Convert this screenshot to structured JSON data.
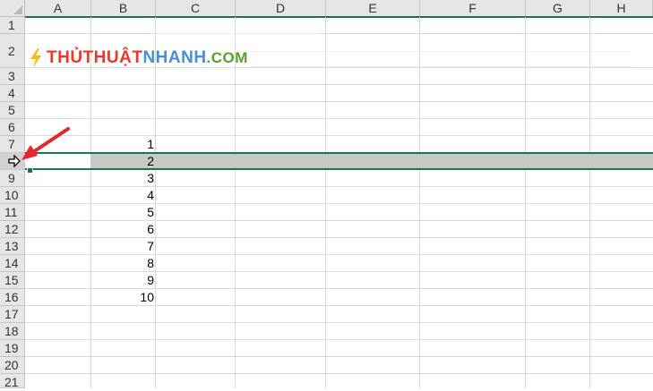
{
  "spreadsheet": {
    "columns": [
      "A",
      "B",
      "C",
      "D",
      "E",
      "F",
      "G",
      "H"
    ],
    "rows": [
      "1",
      "2",
      "3",
      "4",
      "5",
      "6",
      "7",
      "8",
      "9",
      "10",
      "11",
      "12",
      "13",
      "14",
      "15",
      "16",
      "17",
      "18",
      "19",
      "20",
      "21"
    ],
    "selected_row": "8",
    "column_b_values": [
      "1",
      "2",
      "3",
      "4",
      "5",
      "6",
      "7",
      "8",
      "9",
      "10"
    ]
  },
  "logo": {
    "part1": "THỦTHUẬT",
    "part2": "NHANH",
    "part3": ".COM"
  },
  "colors": {
    "accent": "#217346",
    "arrow": "#e8262b",
    "selection_band": "#c8c8c8"
  },
  "icons": {
    "cursor": "move-arrow-icon",
    "annotation": "red-arrow-icon"
  }
}
